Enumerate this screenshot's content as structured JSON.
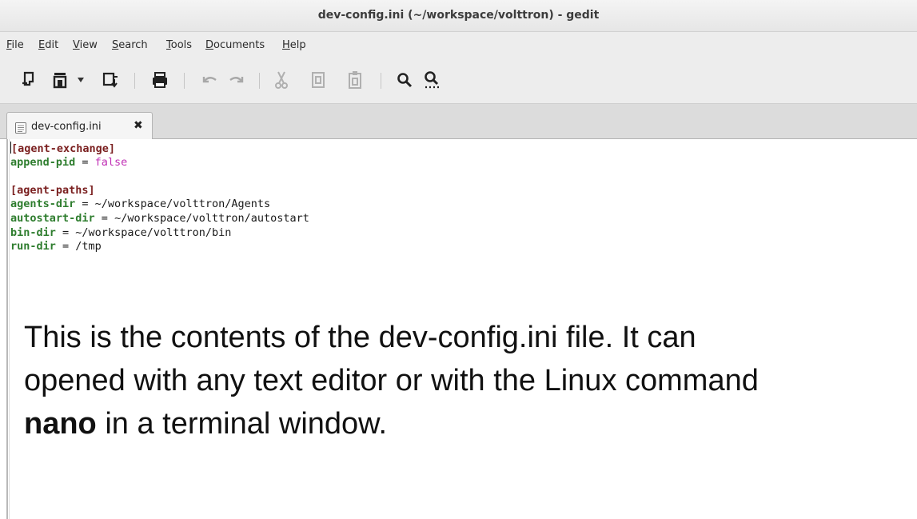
{
  "window": {
    "title": "dev-config.ini (~/workspace/volttron) - gedit"
  },
  "menubar": {
    "items": [
      "File",
      "Edit",
      "View",
      "Search",
      "Tools",
      "Documents",
      "Help"
    ]
  },
  "toolbar": {
    "buttons": [
      {
        "name": "new-document",
        "icon": "new-document-icon"
      },
      {
        "name": "open",
        "icon": "open-folder-icon"
      },
      {
        "name": "open-recent-dropdown",
        "icon": "chevron-down-icon"
      },
      {
        "name": "save",
        "icon": "save-icon"
      },
      {
        "name": "print",
        "icon": "print-icon"
      },
      {
        "name": "undo",
        "icon": "undo-icon"
      },
      {
        "name": "redo",
        "icon": "redo-icon"
      },
      {
        "name": "cut",
        "icon": "cut-icon"
      },
      {
        "name": "copy",
        "icon": "copy-icon"
      },
      {
        "name": "paste",
        "icon": "paste-icon"
      },
      {
        "name": "find",
        "icon": "search-icon"
      },
      {
        "name": "find-replace",
        "icon": "search-replace-icon"
      }
    ]
  },
  "tabs": [
    {
      "label": "dev-config.ini",
      "close": "✖"
    }
  ],
  "editor": {
    "lines": [
      [
        {
          "t": "sec",
          "v": "[agent-exchange]"
        }
      ],
      [
        {
          "t": "key",
          "v": "append-pid"
        },
        {
          "t": "eq",
          "v": " = "
        },
        {
          "t": "val-bool",
          "v": "false"
        }
      ],
      [],
      [
        {
          "t": "sec",
          "v": "[agent-paths]"
        }
      ],
      [
        {
          "t": "key",
          "v": "agents-dir"
        },
        {
          "t": "eq",
          "v": " = "
        },
        {
          "t": "val",
          "v": "~/workspace/volttron/Agents"
        }
      ],
      [
        {
          "t": "key",
          "v": "autostart-dir"
        },
        {
          "t": "eq",
          "v": " = "
        },
        {
          "t": "val",
          "v": "~/workspace/volttron/autostart"
        }
      ],
      [
        {
          "t": "key",
          "v": "bin-dir"
        },
        {
          "t": "eq",
          "v": " = "
        },
        {
          "t": "val",
          "v": "~/workspace/volttron/bin"
        }
      ],
      [
        {
          "t": "key",
          "v": "run-dir"
        },
        {
          "t": "eq",
          "v": " = "
        },
        {
          "t": "val",
          "v": "/tmp"
        }
      ]
    ]
  },
  "note": {
    "line1": "This is the contents of the dev-config.ini file. It can",
    "line2": "opened with any text editor or with the Linux command",
    "bold_word": "nano",
    "line3_rest": " in a terminal window."
  },
  "colors": {
    "section": "#7a1f1f",
    "key": "#2e7d2e",
    "boolean": "#c02fb5"
  }
}
